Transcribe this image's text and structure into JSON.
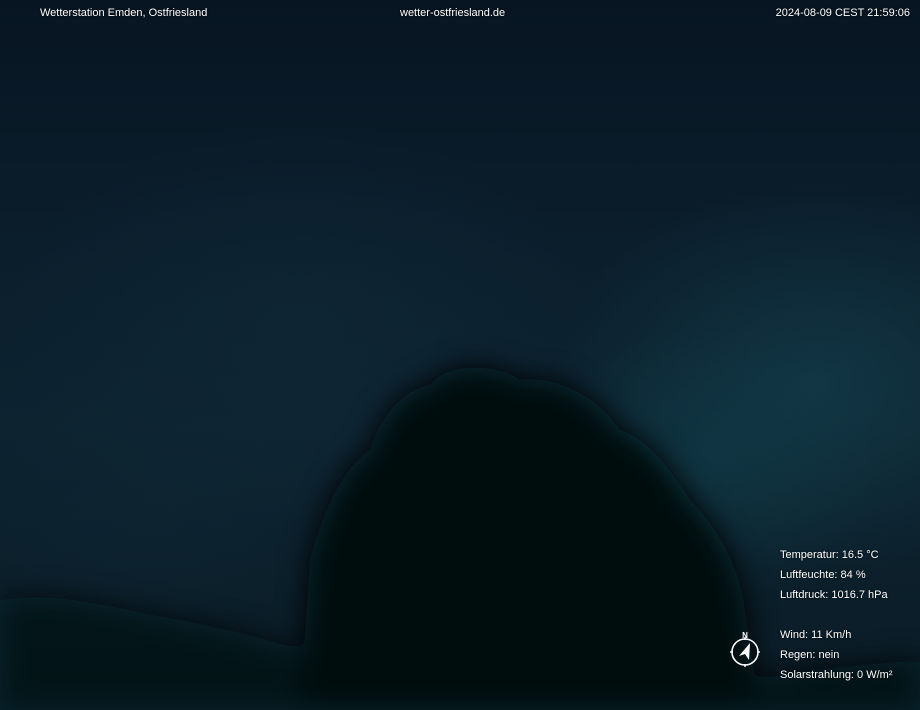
{
  "header": {
    "station": "Wetterstation Emden, Ostfriesland",
    "website": "wetter-ostfriesland.de",
    "timestamp": "2024-08-09 CEST 21:59:06"
  },
  "readings": {
    "temperature": "Temperatur: 16.5 °C",
    "humidity": "Luftfeuchte: 84 %",
    "pressure": "Luftdruck: 1016.7 hPa",
    "wind": "Wind: 11 Km/h",
    "rain": "Regen: nein",
    "solar": "Solarstrahlung: 0 W/m²"
  },
  "compass": {
    "north_label": "N",
    "icon": "wind-direction-compass-icon"
  },
  "colors": {
    "sky_dark": "#071520",
    "sky_teal": "#16464f",
    "tree": "#040b10",
    "text": "#ffffff"
  }
}
